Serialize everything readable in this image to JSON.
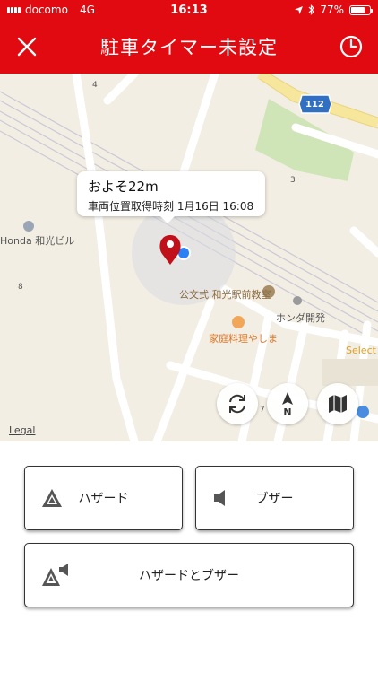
{
  "status": {
    "carrier": "docomo",
    "network": "4G",
    "time": "16:13",
    "battery": "77%",
    "battery_level": 0.77
  },
  "nav": {
    "title": "駐車タイマー未設定"
  },
  "map": {
    "labels": {
      "route_112": "112",
      "num_4": "4",
      "num_3": "3",
      "num_8": "8",
      "num_7": "7",
      "honda_building": "Honda 和光ビル",
      "kumon": "公文式 和光駅前教室",
      "honda_kaihatsu": "ホンダ開発",
      "restaurant": "家庭料理やしま",
      "select": "Select",
      "legal": "Legal"
    },
    "callout": {
      "title": "およそ22m",
      "subtitle": "車両位置取得時刻 1月16日 16:08"
    }
  },
  "buttons": {
    "hazard": "ハザード",
    "buzzer": "ブザー",
    "hazard_and_buzzer": "ハザードとブザー"
  },
  "colors": {
    "brand_red": "#e00a10",
    "pin_red": "#c0101a",
    "location_blue": "#2a82f4"
  }
}
